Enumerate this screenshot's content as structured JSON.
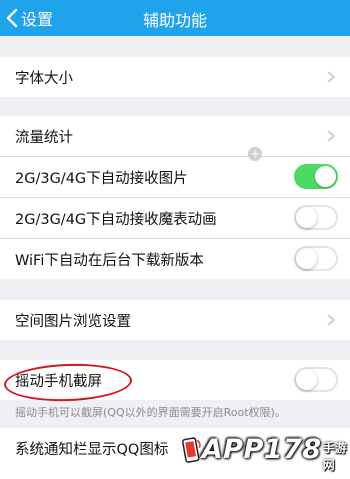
{
  "navbar": {
    "back_label": "设置",
    "title": "辅助功能"
  },
  "groups": [
    {
      "rows": [
        {
          "label": "字体大小",
          "control": "chevron"
        }
      ]
    },
    {
      "rows": [
        {
          "label": "流量统计",
          "control": "chevron"
        },
        {
          "label": "2G/3G/4G下自动接收图片",
          "control": "toggle",
          "on": true
        },
        {
          "label": "2G/3G/4G下自动接收魔表动画",
          "control": "toggle",
          "on": false
        },
        {
          "label": "WiFi下自动在后台下载新版本",
          "control": "toggle",
          "on": false
        }
      ]
    },
    {
      "rows": [
        {
          "label": "空间图片浏览设置",
          "control": "chevron"
        }
      ]
    },
    {
      "rows": [
        {
          "label": "摇动手机截屏",
          "control": "toggle",
          "on": false
        }
      ]
    },
    {
      "rows": [
        {
          "label": "系统通知栏显示QQ图标"
        }
      ]
    }
  ],
  "footnote": "摇动手机可以截屏(QQ以外的界面需要开启Root权限)。",
  "watermark": {
    "text": "APP178",
    "sub": "手游网"
  },
  "colors": {
    "navbar": "#1fa3eb",
    "toggle_on": "#4cd964",
    "annotation": "#d0191f"
  }
}
